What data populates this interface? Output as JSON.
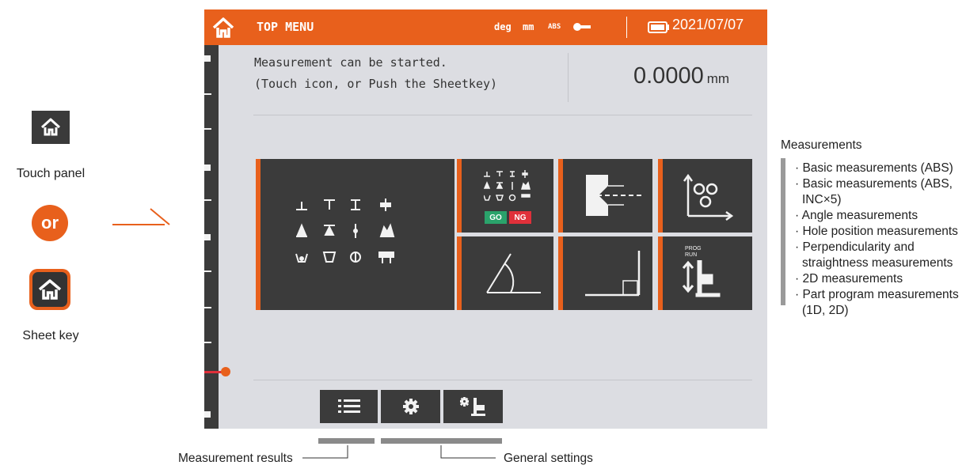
{
  "legend": {
    "touch_panel_label": "Touch panel",
    "or_label": "or",
    "sheet_key_label": "Sheet key"
  },
  "titlebar": {
    "title": "TOP MENU",
    "unit_deg": "deg",
    "unit_mm": "mm",
    "mode": "ABS",
    "date": "2021/07/07"
  },
  "message": {
    "line1": "Measurement can be started.",
    "line2": "(Touch icon, or Push the Sheetkey)"
  },
  "reading": {
    "value": "0.0000",
    "unit": "mm"
  },
  "tiles": {
    "go_label": "GO",
    "ng_label": "NG",
    "prog_label": "PROG",
    "run_label": "RUN"
  },
  "annotations": {
    "measurements_heading": "Measurements",
    "measurement_items": [
      "· Basic measurements (ABS)",
      "· Basic measurements (ABS, INC×5)",
      "· Angle measurements",
      "· Hole position measurements",
      "· Perpendicularity and straightness measurements",
      "· 2D measurements",
      "· Part program measurements (1D, 2D)"
    ],
    "measurement_results": "Measurement results",
    "general_settings": "General settings"
  },
  "colors": {
    "accent": "#e8601c",
    "tile": "#3b3b3b",
    "screen_bg": "#dcdde2",
    "go": "#2aa36b",
    "ng": "#e0303a"
  },
  "icons": {
    "home": "home-icon",
    "key": "key-icon",
    "battery": "battery-icon",
    "list": "list-icon",
    "gear": "gear-icon",
    "settings_gear_probe": "gear-probe-icon"
  }
}
